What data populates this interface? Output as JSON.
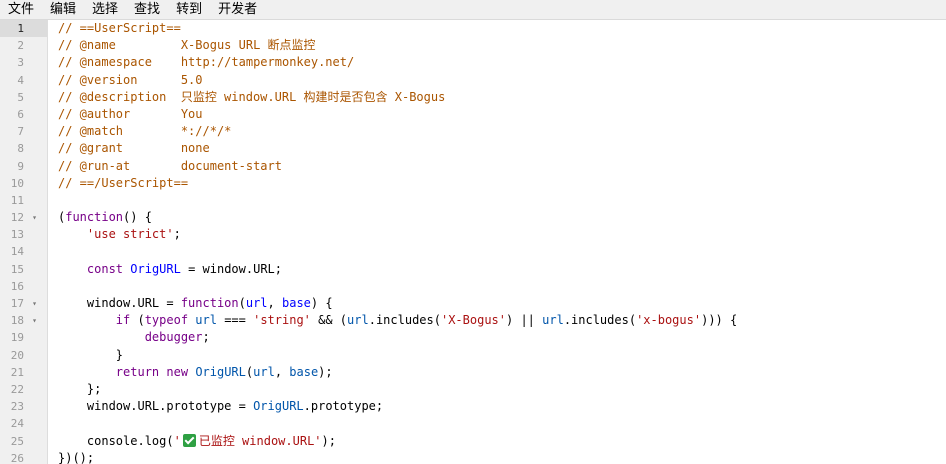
{
  "menu": {
    "items": [
      "文件",
      "编辑",
      "选择",
      "查找",
      "转到",
      "开发者"
    ]
  },
  "editor": {
    "active_line": 1,
    "gutter": [
      {
        "n": "1",
        "fold": false
      },
      {
        "n": "2",
        "fold": false
      },
      {
        "n": "3",
        "fold": false
      },
      {
        "n": "4",
        "fold": false
      },
      {
        "n": "5",
        "fold": false
      },
      {
        "n": "6",
        "fold": false
      },
      {
        "n": "7",
        "fold": false
      },
      {
        "n": "8",
        "fold": false
      },
      {
        "n": "9",
        "fold": false
      },
      {
        "n": "10",
        "fold": false
      },
      {
        "n": "11",
        "fold": false
      },
      {
        "n": "12",
        "fold": true
      },
      {
        "n": "13",
        "fold": false
      },
      {
        "n": "14",
        "fold": false
      },
      {
        "n": "15",
        "fold": false
      },
      {
        "n": "16",
        "fold": false
      },
      {
        "n": "17",
        "fold": true
      },
      {
        "n": "18",
        "fold": true
      },
      {
        "n": "19",
        "fold": false
      },
      {
        "n": "20",
        "fold": false
      },
      {
        "n": "21",
        "fold": false
      },
      {
        "n": "22",
        "fold": false
      },
      {
        "n": "23",
        "fold": false
      },
      {
        "n": "24",
        "fold": false
      },
      {
        "n": "25",
        "fold": false
      },
      {
        "n": "26",
        "fold": false
      }
    ],
    "lines": [
      [
        [
          "c-comment",
          "// ==UserScript=="
        ]
      ],
      [
        [
          "c-comment",
          "// @name         X-Bogus URL 断点监控"
        ]
      ],
      [
        [
          "c-comment",
          "// @namespace    http://tampermonkey.net/"
        ]
      ],
      [
        [
          "c-comment",
          "// @version      5.0"
        ]
      ],
      [
        [
          "c-comment",
          "// @description  只监控 window.URL 构建时是否包含 X-Bogus"
        ]
      ],
      [
        [
          "c-comment",
          "// @author       You"
        ]
      ],
      [
        [
          "c-comment",
          "// @match        *://*/*"
        ]
      ],
      [
        [
          "c-comment",
          "// @grant        none"
        ]
      ],
      [
        [
          "c-comment",
          "// @run-at       document-start"
        ]
      ],
      [
        [
          "c-comment",
          "// ==/UserScript=="
        ]
      ],
      [],
      [
        [
          "c-plain",
          "("
        ],
        [
          "c-kw",
          "function"
        ],
        [
          "c-plain",
          "() {"
        ]
      ],
      [
        [
          "c-plain",
          "    "
        ],
        [
          "c-str",
          "'use strict'"
        ],
        [
          "c-plain",
          ";"
        ]
      ],
      [],
      [
        [
          "c-plain",
          "    "
        ],
        [
          "c-kw",
          "const"
        ],
        [
          "c-plain",
          " "
        ],
        [
          "c-def",
          "OrigURL"
        ],
        [
          "c-plain",
          " = window.URL;"
        ]
      ],
      [],
      [
        [
          "c-plain",
          "    window.URL = "
        ],
        [
          "c-kw",
          "function"
        ],
        [
          "c-plain",
          "("
        ],
        [
          "c-def",
          "url"
        ],
        [
          "c-plain",
          ", "
        ],
        [
          "c-def",
          "base"
        ],
        [
          "c-plain",
          ") {"
        ]
      ],
      [
        [
          "c-plain",
          "        "
        ],
        [
          "c-kw",
          "if"
        ],
        [
          "c-plain",
          " ("
        ],
        [
          "c-kw",
          "typeof"
        ],
        [
          "c-plain",
          " "
        ],
        [
          "c-var2",
          "url"
        ],
        [
          "c-plain",
          " === "
        ],
        [
          "c-str",
          "'string'"
        ],
        [
          "c-plain",
          " && ("
        ],
        [
          "c-var2",
          "url"
        ],
        [
          "c-plain",
          ".includes("
        ],
        [
          "c-str",
          "'X-Bogus'"
        ],
        [
          "c-plain",
          ") || "
        ],
        [
          "c-var2",
          "url"
        ],
        [
          "c-plain",
          ".includes("
        ],
        [
          "c-str",
          "'x-bogus'"
        ],
        [
          "c-plain",
          "))) {"
        ]
      ],
      [
        [
          "c-plain",
          "            "
        ],
        [
          "c-kw",
          "debugger"
        ],
        [
          "c-plain",
          ";"
        ]
      ],
      [
        [
          "c-plain",
          "        }"
        ]
      ],
      [
        [
          "c-plain",
          "        "
        ],
        [
          "c-kw",
          "return"
        ],
        [
          "c-plain",
          " "
        ],
        [
          "c-kw",
          "new"
        ],
        [
          "c-plain",
          " "
        ],
        [
          "c-var2",
          "OrigURL"
        ],
        [
          "c-plain",
          "("
        ],
        [
          "c-var2",
          "url"
        ],
        [
          "c-plain",
          ", "
        ],
        [
          "c-var2",
          "base"
        ],
        [
          "c-plain",
          ");"
        ]
      ],
      [
        [
          "c-plain",
          "    };"
        ]
      ],
      [
        [
          "c-plain",
          "    window.URL.prototype = "
        ],
        [
          "c-var2",
          "OrigURL"
        ],
        [
          "c-plain",
          ".prototype;"
        ]
      ],
      [],
      [
        [
          "c-plain",
          "    console.log("
        ],
        [
          "c-str",
          "'"
        ],
        [
          "icon",
          "check-icon"
        ],
        [
          "c-str",
          "已监控 window.URL'"
        ],
        [
          "c-plain",
          ");"
        ]
      ],
      [
        [
          "c-plain",
          "})();"
        ]
      ]
    ]
  }
}
